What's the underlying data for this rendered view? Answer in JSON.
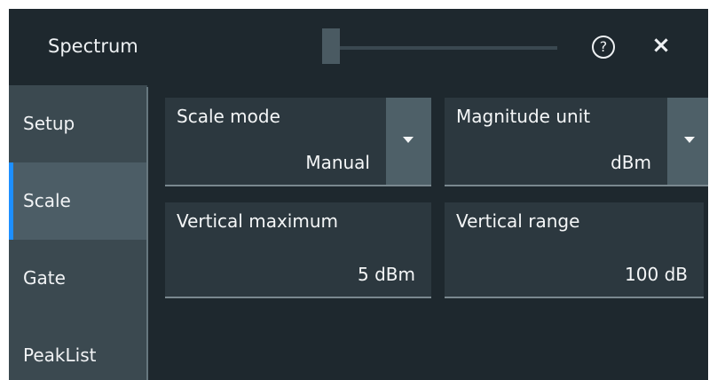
{
  "header": {
    "title": "Spectrum",
    "help_icon": "?",
    "close_icon": "×"
  },
  "sidebar": {
    "items": [
      {
        "label": "Setup",
        "active": false
      },
      {
        "label": "Scale",
        "active": true
      },
      {
        "label": "Gate",
        "active": false
      },
      {
        "label": "PeakList",
        "active": false
      }
    ]
  },
  "fields": {
    "scale_mode": {
      "label": "Scale mode",
      "value": "Manual"
    },
    "magnitude_unit": {
      "label": "Magnitude unit",
      "value": "dBm"
    },
    "vertical_maximum": {
      "label": "Vertical maximum",
      "value": "5 dBm"
    },
    "vertical_range": {
      "label": "Vertical range",
      "value": "100 dB"
    }
  },
  "colors": {
    "background": "#1e282e",
    "sidebar": "#3b4950",
    "active_tab": "#4c5d66",
    "accent": "#1d8fff",
    "field_background": "#2c383f",
    "dropdown_button": "#4e6068"
  },
  "icons": {
    "help": "help-icon",
    "close": "close-icon",
    "dropdown": "chevron-down-icon"
  }
}
